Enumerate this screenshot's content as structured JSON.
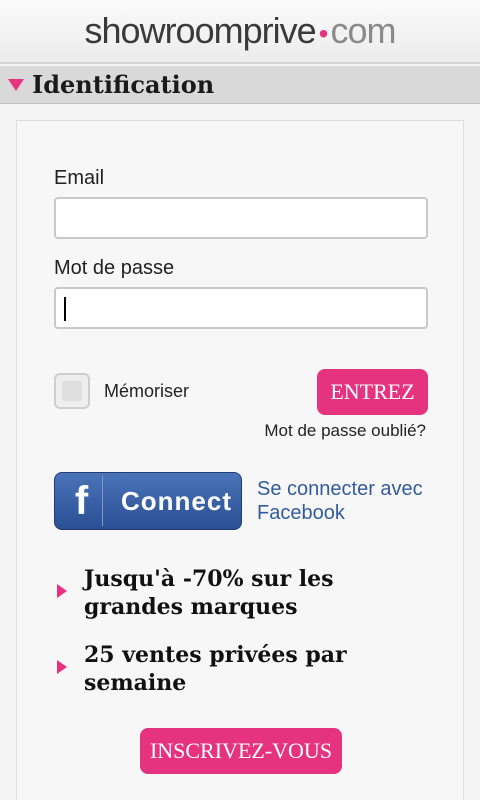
{
  "header": {
    "logo_brand": "showroomprive",
    "logo_dot": "•",
    "logo_com": "com"
  },
  "section": {
    "title": "Identification"
  },
  "form": {
    "email_label": "Email",
    "email_value": "",
    "password_label": "Mot de passe",
    "password_value": "",
    "remember_label": "Mémoriser",
    "remember_checked": false,
    "submit_label": "ENTREZ",
    "forgot_label": "Mot de passe oublié?"
  },
  "facebook": {
    "icon_letter": "f",
    "button_label": "Connect",
    "link_text": "Se connecter avec Facebook"
  },
  "promos": [
    {
      "text": "Jusqu'à -70% sur les grandes marques"
    },
    {
      "text": "25 ventes privées par semaine"
    }
  ],
  "signup": {
    "label": "INSCRIVEZ-VOUS"
  },
  "colors": {
    "accent": "#e6337f",
    "facebook": "#3b5998"
  }
}
